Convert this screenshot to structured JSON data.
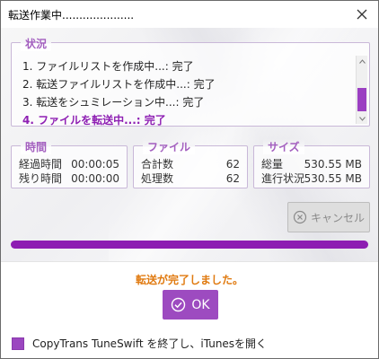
{
  "window": {
    "title": "転送作業中....................."
  },
  "status": {
    "title": "状況",
    "lines": [
      "1. ファイルリストを作成中...: 完了",
      "2. 転送ファイルリストを作成中...: 完了",
      "3. 転送をシュミレーション中...: 完了",
      "4. ファイルを転送中...: 完了"
    ],
    "active_index": 3
  },
  "time": {
    "title": "時間",
    "elapsed_label": "経過時間",
    "elapsed_value": "00:00:05",
    "remaining_label": "残り時間",
    "remaining_value": "00:00:00"
  },
  "files": {
    "title": "ファイル",
    "total_label": "合計数",
    "total_value": "62",
    "processed_label": "処理数",
    "processed_value": "62"
  },
  "size": {
    "title": "サイズ",
    "total_label": "総量",
    "total_value": "530.55 MB",
    "progress_label": "進行状況",
    "progress_value": "530.55 MB"
  },
  "cancel_button": {
    "label": "キャンセル"
  },
  "progress": {
    "fraction": 1.0
  },
  "footer": {
    "done_message": "転送が完了しました。",
    "ok_label": "OK",
    "checkbox_label": "CopyTrans TuneSwift を終了し、iTunesを開く",
    "checkbox_checked": true
  },
  "colors": {
    "accent": "#8d1db2",
    "accent_light": "#9d4bc0",
    "group_title": "#a35fbf",
    "done_text": "#e07a10"
  },
  "icons": {
    "close": "close-icon",
    "cancel": "cancel-x-circle-icon",
    "ok": "check-circle-icon"
  }
}
